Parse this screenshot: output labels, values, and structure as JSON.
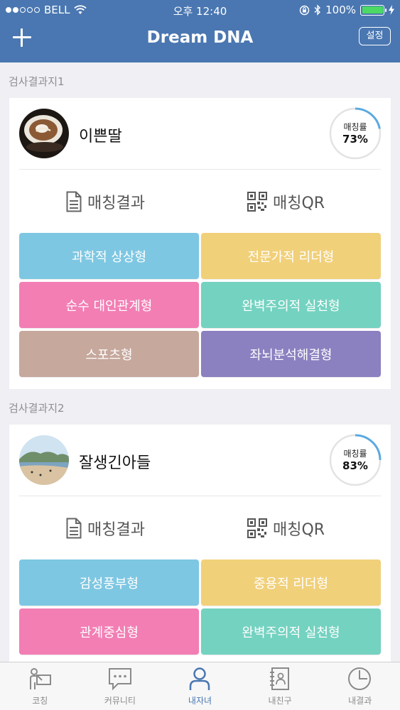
{
  "status_bar": {
    "carrier": "BELL",
    "time": "오후 12:40",
    "battery": "100%",
    "signal_bars_filled": 2,
    "signal_bars_total": 5
  },
  "nav": {
    "title": "Dream DNA",
    "settings_label": "설정",
    "add_icon": "plus-icon"
  },
  "results": [
    {
      "section_label": "검사결과지1",
      "name": "이쁜딸",
      "match_label": "매칭률",
      "match_value": "73%",
      "match_fraction": 0.73,
      "result_label": "매칭결과",
      "qr_label": "매칭QR",
      "tiles": [
        {
          "label": "과학적 상상형",
          "color": "#7ec7e2"
        },
        {
          "label": "전문가적 리더형",
          "color": "#f1d07a"
        },
        {
          "label": "순수 대인관계형",
          "color": "#f27eb4"
        },
        {
          "label": "완벽주의적 실천형",
          "color": "#74d2c0"
        },
        {
          "label": "스포츠형",
          "color": "#c6a89d"
        },
        {
          "label": "좌뇌분석해결형",
          "color": "#8b80c0"
        }
      ]
    },
    {
      "section_label": "검사결과지2",
      "name": "잘생긴아들",
      "match_label": "매칭률",
      "match_value": "83%",
      "match_fraction": 0.83,
      "result_label": "매칭결과",
      "qr_label": "매칭QR",
      "tiles": [
        {
          "label": "감성풍부형",
          "color": "#7ec7e2"
        },
        {
          "label": "중용적 리더형",
          "color": "#f1d07a"
        },
        {
          "label": "관계중심형",
          "color": "#f27eb4"
        },
        {
          "label": "완벽주의적 실천형",
          "color": "#74d2c0"
        }
      ]
    }
  ],
  "tabbar": {
    "items": [
      {
        "label": "코칭",
        "icon": "coaching-icon",
        "active": false
      },
      {
        "label": "커뮤니티",
        "icon": "chat-bubble-icon",
        "active": false
      },
      {
        "label": "내자녀",
        "icon": "person-icon",
        "active": true
      },
      {
        "label": "내친구",
        "icon": "contacts-book-icon",
        "active": false
      },
      {
        "label": "내결과",
        "icon": "clock-chart-icon",
        "active": false
      }
    ]
  },
  "colors": {
    "brand": "#4a77b1",
    "ring_progress": "#5aa9e0",
    "ring_track": "#e3e3e6"
  }
}
